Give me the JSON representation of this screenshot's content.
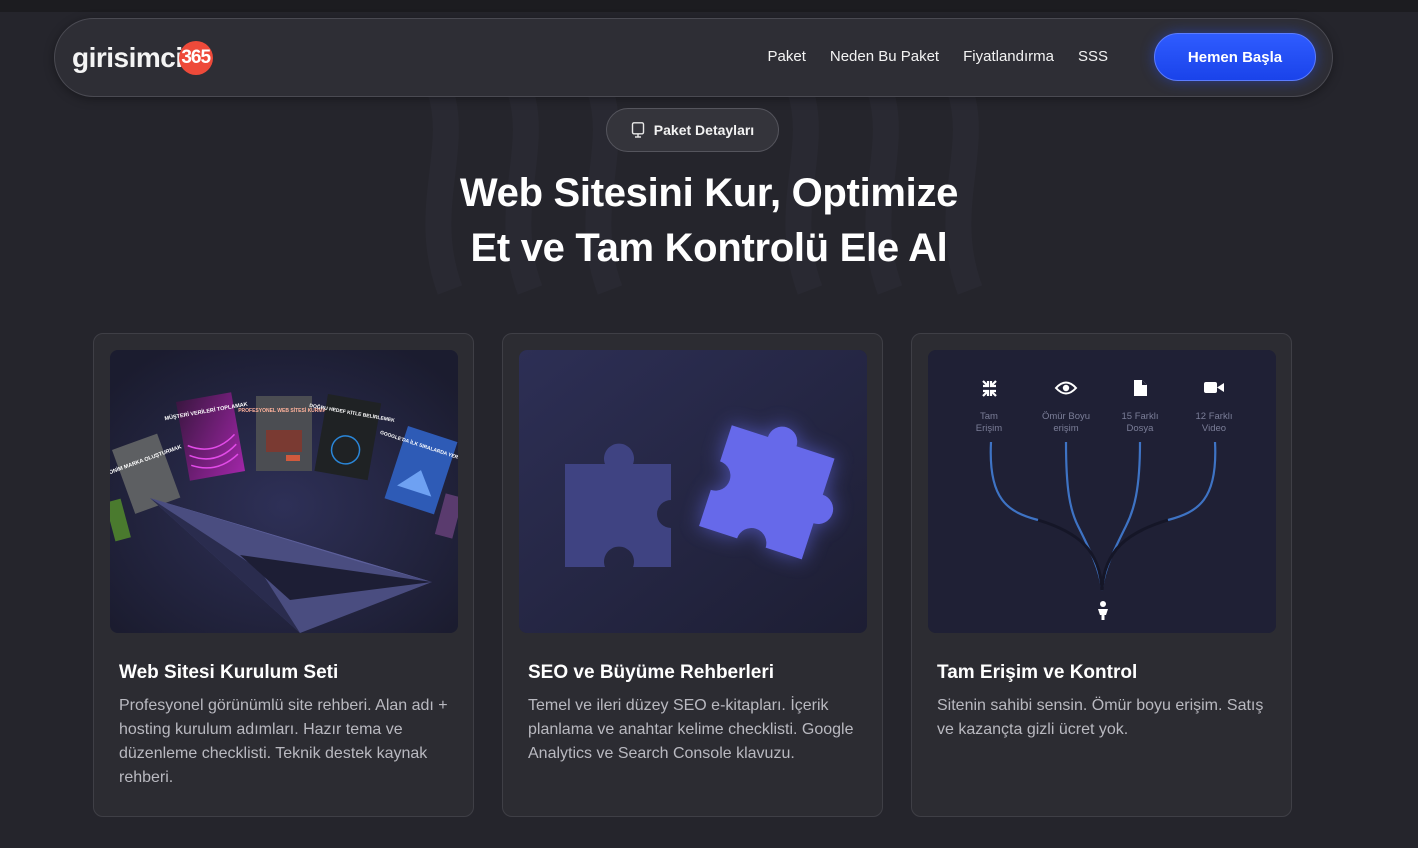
{
  "brand": {
    "name": "girisimci",
    "badge": "365",
    "badge_color": "#ee4a3a"
  },
  "nav": {
    "links": [
      "Paket",
      "Neden Bu Paket",
      "Fiyatlandırma",
      "SSS"
    ],
    "cta": "Hemen Başla"
  },
  "hero": {
    "pill": "Paket Detayları",
    "title_line1": "Web Sitesini Kur, Optimize",
    "title_line2": "Et ve Tam Kontrolü Ele Al"
  },
  "cards": [
    {
      "title": "Web Sitesi Kurulum Seti",
      "desc": "Profesyonel görünümlü site rehberi. Alan adı + hosting kurulum adımları. Hazır tema ve düzenleme checklisti. Teknik destek kaynak rehberi.",
      "books": [
        "ANONİM MARKA OLUŞTURMAK",
        "MÜŞTERİ VERİLERİ TOPLAMAK",
        "PROFESYONEL WEB SİTESİ KURMAK",
        "DOĞRU HEDEF KİTLE BELİRLEMEK",
        "GOOGLE'DA İLK SIRALARDA YER ALMAK"
      ]
    },
    {
      "title": "SEO ve Büyüme Rehberleri",
      "desc": "Temel ve ileri düzey SEO e-kitapları. İçerik planlama ve anahtar kelime checklisti. Google Analytics ve Search Console klavuzu."
    },
    {
      "title": "Tam Erişim ve Kontrol",
      "desc": "Sitenin sahibi sensin. Ömür boyu erişim. Satış ve kazançta gizli ücret yok.",
      "features": [
        {
          "label1": "Tam",
          "label2": "Erişim",
          "icon": "compress-icon"
        },
        {
          "label1": "Ömür Boyu",
          "label2": "erişim",
          "icon": "eye-icon"
        },
        {
          "label1": "15 Farklı",
          "label2": "Dosya",
          "icon": "file-icon"
        },
        {
          "label1": "12 Farklı",
          "label2": "Video",
          "icon": "video-icon"
        }
      ]
    }
  ],
  "colors": {
    "accent": "#2449f5",
    "background": "#25252c",
    "card": "#2c2c32"
  }
}
